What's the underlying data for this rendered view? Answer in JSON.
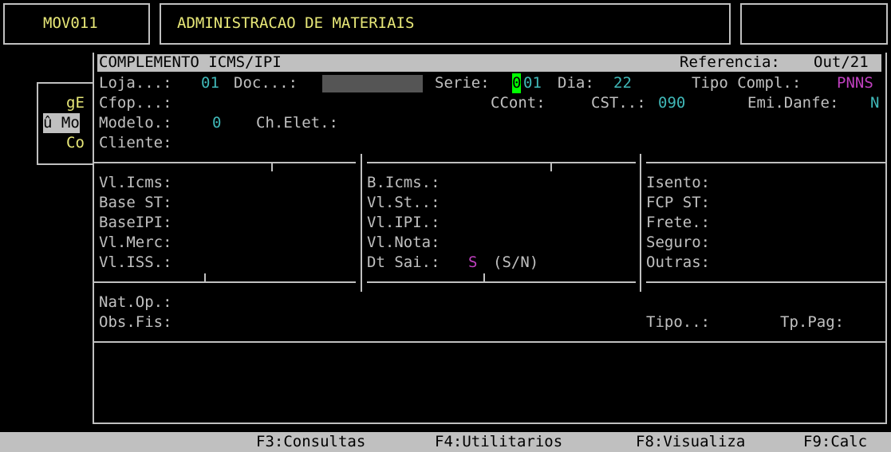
{
  "header": {
    "program_code": "MOV011",
    "title": "ADMINISTRACAO DE MATERIAIS",
    "right_box": ""
  },
  "background_menu": {
    "items": [
      "gE",
      "û Mo",
      "Co"
    ]
  },
  "dialog": {
    "title": "COMPLEMENTO ICMS/IPI",
    "referencia_label": "Referencia:",
    "referencia_value": "Out/21",
    "row1": {
      "loja_label": "Loja...:",
      "loja_value": "01",
      "doc_label": "Doc...:",
      "serie_label": "Serie:",
      "serie_cursor": "0",
      "serie_rest": "01",
      "dia_label": "Dia:",
      "dia_value": "22",
      "tipo_label": "Tipo Compl.:",
      "tipo_value": "PNNS"
    },
    "row2": {
      "cfop_label": "Cfop...:",
      "ccont_label": "CCont:",
      "cst_label": "CST..:",
      "cst_value": "090",
      "emi_label": "Emi.Danfe:",
      "emi_value": "N"
    },
    "row3": {
      "modelo_label": "Modelo.:",
      "modelo_value": "0",
      "chelet_label": "Ch.Elet.:"
    },
    "row4": {
      "cliente_label": "Cliente:"
    },
    "col1": [
      "Vl.Icms:",
      "Base ST:",
      "BaseIPI:",
      "Vl.Merc:",
      "Vl.ISS.:"
    ],
    "col2": [
      "B.Icms.:",
      "Vl.St..:",
      "Vl.IPI.:",
      "Vl.Nota:"
    ],
    "dtsai_label": "Dt Sai.:",
    "dtsai_value": "S",
    "dtsai_hint": "(S/N)",
    "col3": [
      "Isento:",
      "FCP ST:",
      "Frete.:",
      "Seguro:",
      "Outras:"
    ],
    "natop_label": "Nat.Op.:",
    "obsfis_label": "Obs.Fis:",
    "tipo2_label": "Tipo..:",
    "tppag_label": "Tp.Pag:"
  },
  "function_keys": [
    "F3:Consultas",
    "F4:Utilitarios",
    "F8:Visualiza",
    "F9:Calc"
  ]
}
